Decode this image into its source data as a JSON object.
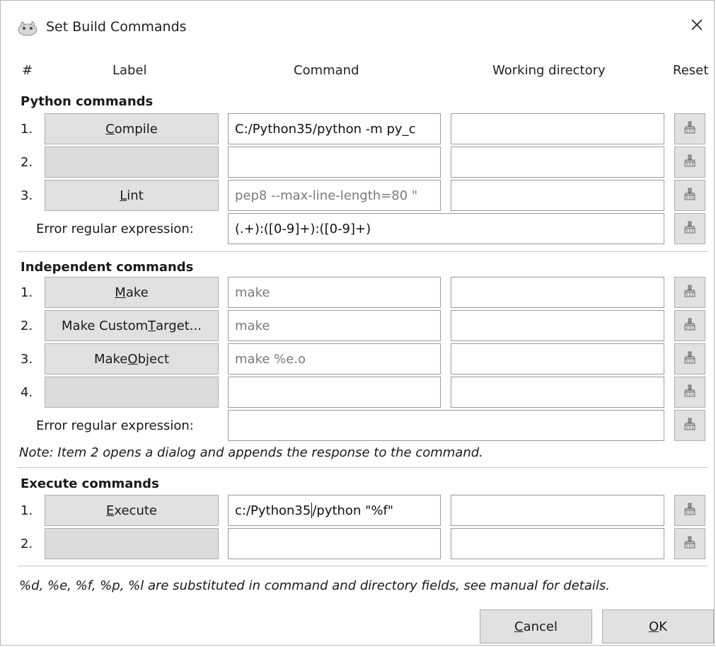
{
  "window": {
    "title": "Set Build Commands",
    "close_glyph": "✕"
  },
  "headers": {
    "num": "#",
    "label": "Label",
    "command": "Command",
    "workdir": "Working directory",
    "reset": "Reset"
  },
  "python": {
    "title": "Python commands",
    "rows": [
      {
        "num": "1.",
        "label_pre": "",
        "label_u": "C",
        "label_post": "ompile",
        "command": "C:/Python35/python -m py_c",
        "workdir": ""
      },
      {
        "num": "2.",
        "label_pre": "",
        "label_u": "",
        "label_post": "",
        "command": "",
        "workdir": ""
      },
      {
        "num": "3.",
        "label_pre": "",
        "label_u": "L",
        "label_post": "int",
        "command": "pep8 --max-line-length=80 \"",
        "workdir": ""
      }
    ],
    "error_label": "Error regular expression:",
    "error_value": "(.+):([0-9]+):([0-9]+)"
  },
  "independent": {
    "title": "Independent commands",
    "rows": [
      {
        "num": "1.",
        "label_pre": "",
        "label_u": "M",
        "label_post": "ake",
        "command": "make",
        "workdir": ""
      },
      {
        "num": "2.",
        "label_pre": "Make Custom ",
        "label_u": "T",
        "label_post": "arget...",
        "command": "make",
        "workdir": ""
      },
      {
        "num": "3.",
        "label_pre": "Make ",
        "label_u": "O",
        "label_post": "bject",
        "command": "make %e.o",
        "workdir": ""
      },
      {
        "num": "4.",
        "label_pre": "",
        "label_u": "",
        "label_post": "",
        "command": "",
        "workdir": ""
      }
    ],
    "error_label": "Error regular expression:",
    "error_value": "",
    "note": "Note: Item 2 opens a dialog and appends the response to the command."
  },
  "execute": {
    "title": "Execute commands",
    "rows": [
      {
        "num": "1.",
        "label_pre": "",
        "label_u": "E",
        "label_post": "xecute",
        "command_a": "c:/Python35",
        "command_b": "/python \"%f\"",
        "workdir": ""
      },
      {
        "num": "2.",
        "label_pre": "",
        "label_u": "",
        "label_post": "",
        "command": "",
        "workdir": ""
      }
    ]
  },
  "footer_note": "%d, %e, %f, %p, %l are substituted in command and directory fields, see manual for details.",
  "buttons": {
    "cancel_u": "C",
    "cancel_rest": "ancel",
    "ok_u": "O",
    "ok_rest": "K"
  },
  "icons": {
    "app": "geany-icon",
    "close": "close-icon",
    "reset": "clear-icon"
  }
}
